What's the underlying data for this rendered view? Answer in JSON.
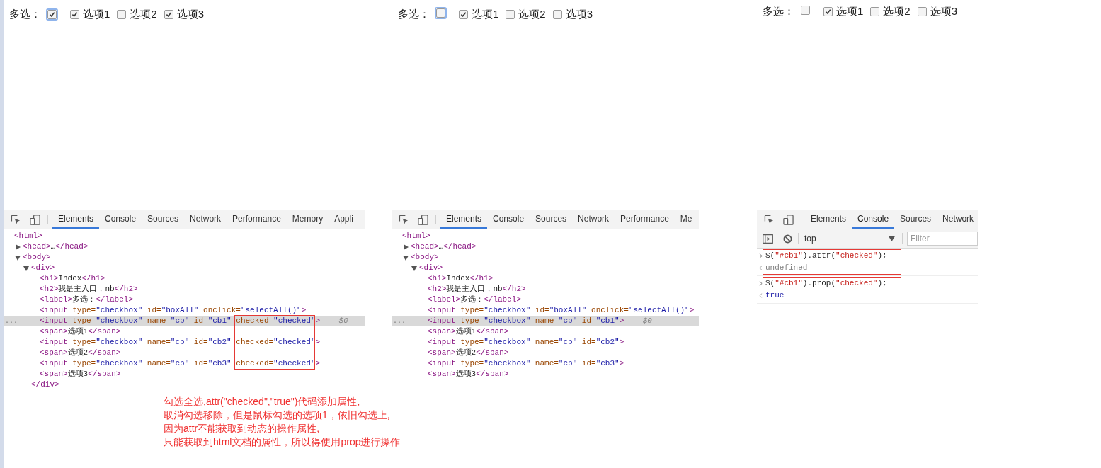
{
  "panels": [
    {
      "kind": "elements",
      "checkboxes": {
        "label": "多选：",
        "select_all": {
          "checked": true,
          "focused": true
        },
        "options": [
          {
            "label": "选项1",
            "checked": true
          },
          {
            "label": "选项2",
            "checked": false
          },
          {
            "label": "选项3",
            "checked": true
          }
        ]
      },
      "tabs": [
        {
          "label": "Elements",
          "selected": true
        },
        {
          "label": "Console",
          "selected": false
        },
        {
          "label": "Sources",
          "selected": false
        },
        {
          "label": "Network",
          "selected": false
        },
        {
          "label": "Performance",
          "selected": false
        },
        {
          "label": "Memory",
          "selected": false
        },
        {
          "label": "Appli",
          "selected": false
        }
      ],
      "highlight_box": true,
      "tree": [
        {
          "tokens": [
            {
              "kind": "tag",
              "text": "<html>"
            }
          ],
          "children": [
            {
              "expanded": false,
              "tokens": [
                {
                  "kind": "tag",
                  "text": "<head>"
                },
                {
                  "kind": "text",
                  "text": "…"
                },
                {
                  "kind": "tag",
                  "text": "</head>"
                }
              ]
            },
            {
              "expanded": true,
              "tokens": [
                {
                  "kind": "tag",
                  "text": "<body>"
                }
              ],
              "children": [
                {
                  "expanded": true,
                  "tokens": [
                    {
                      "kind": "tag",
                      "text": "<div>"
                    }
                  ],
                  "close": [
                    {
                      "kind": "tag",
                      "text": "</div>"
                    }
                  ],
                  "children": [
                    {
                      "tokens": [
                        {
                          "kind": "tag",
                          "text": "<h1>"
                        },
                        {
                          "kind": "text",
                          "text": "Index"
                        },
                        {
                          "kind": "tag",
                          "text": "</h1>"
                        }
                      ]
                    },
                    {
                      "tokens": [
                        {
                          "kind": "tag",
                          "text": "<h2>"
                        },
                        {
                          "kind": "text",
                          "text": "我是主入口，nb"
                        },
                        {
                          "kind": "tag",
                          "text": "</h2>"
                        }
                      ]
                    },
                    {
                      "tokens": [
                        {
                          "kind": "tag",
                          "text": "<label>"
                        },
                        {
                          "kind": "text",
                          "text": "多选："
                        },
                        {
                          "kind": "tag",
                          "text": "</label>"
                        }
                      ]
                    },
                    {
                      "tokens": [
                        {
                          "kind": "tag",
                          "text": "<input "
                        },
                        {
                          "kind": "attr",
                          "text": "type="
                        },
                        {
                          "kind": "value",
                          "text": "\"checkbox\""
                        },
                        {
                          "kind": "attr",
                          "text": " id="
                        },
                        {
                          "kind": "value",
                          "text": "\"boxAll\""
                        },
                        {
                          "kind": "attr",
                          "text": " onclick="
                        },
                        {
                          "kind": "value",
                          "text": "\"selectAll()\""
                        },
                        {
                          "kind": "tag",
                          "text": ">"
                        }
                      ]
                    },
                    {
                      "selected": true,
                      "gutter": "...",
                      "tokens": [
                        {
                          "kind": "tag",
                          "text": "<input "
                        },
                        {
                          "kind": "attr",
                          "text": "type="
                        },
                        {
                          "kind": "value",
                          "text": "\"checkbox\""
                        },
                        {
                          "kind": "attr",
                          "text": " name="
                        },
                        {
                          "kind": "value",
                          "text": "\"cb\""
                        },
                        {
                          "kind": "attr",
                          "text": " id="
                        },
                        {
                          "kind": "value",
                          "text": "\"cb1\" "
                        },
                        {
                          "kind": "boxed_attr",
                          "text": "checked="
                        },
                        {
                          "kind": "boxed_value",
                          "text": "\"checked\""
                        },
                        {
                          "kind": "tag",
                          "text": ">"
                        },
                        {
                          "kind": "note",
                          "text": " == $0"
                        }
                      ]
                    },
                    {
                      "tokens": [
                        {
                          "kind": "tag",
                          "text": "<span>"
                        },
                        {
                          "kind": "text",
                          "text": "选项1"
                        },
                        {
                          "kind": "tag",
                          "text": "</span>"
                        }
                      ]
                    },
                    {
                      "tokens": [
                        {
                          "kind": "tag",
                          "text": "<input "
                        },
                        {
                          "kind": "attr",
                          "text": "type="
                        },
                        {
                          "kind": "value",
                          "text": "\"checkbox\""
                        },
                        {
                          "kind": "attr",
                          "text": " name="
                        },
                        {
                          "kind": "value",
                          "text": "\"cb\""
                        },
                        {
                          "kind": "attr",
                          "text": " id="
                        },
                        {
                          "kind": "value",
                          "text": "\"cb2\" "
                        },
                        {
                          "kind": "boxed_attr",
                          "text": "checked="
                        },
                        {
                          "kind": "boxed_value",
                          "text": "\"checked\""
                        },
                        {
                          "kind": "tag",
                          "text": ">"
                        }
                      ]
                    },
                    {
                      "tokens": [
                        {
                          "kind": "tag",
                          "text": "<span>"
                        },
                        {
                          "kind": "text",
                          "text": "选项2"
                        },
                        {
                          "kind": "tag",
                          "text": "</span>"
                        }
                      ]
                    },
                    {
                      "tokens": [
                        {
                          "kind": "tag",
                          "text": "<input "
                        },
                        {
                          "kind": "attr",
                          "text": "type="
                        },
                        {
                          "kind": "value",
                          "text": "\"checkbox\""
                        },
                        {
                          "kind": "attr",
                          "text": " name="
                        },
                        {
                          "kind": "value",
                          "text": "\"cb\""
                        },
                        {
                          "kind": "attr",
                          "text": " id="
                        },
                        {
                          "kind": "value",
                          "text": "\"cb3\" "
                        },
                        {
                          "kind": "boxed_attr",
                          "text": "checked="
                        },
                        {
                          "kind": "boxed_value",
                          "text": "\"checked\""
                        },
                        {
                          "kind": "tag",
                          "text": ">"
                        }
                      ]
                    },
                    {
                      "tokens": [
                        {
                          "kind": "tag",
                          "text": "<span>"
                        },
                        {
                          "kind": "text",
                          "text": "选项3"
                        },
                        {
                          "kind": "tag",
                          "text": "</span>"
                        }
                      ]
                    }
                  ]
                }
              ]
            }
          ]
        }
      ],
      "note": [
        "勾选全选,attr(\"checked\",\"true\")代码添加属性,",
        "取消勾选移除，但是鼠标勾选的选项1，依旧勾选上,",
        "因为attr不能获取到动态的操作属性,",
        "只能获取到html文档的属性，所以得使用prop进行操作"
      ]
    },
    {
      "kind": "elements",
      "checkboxes": {
        "label": "多选：",
        "select_all": {
          "checked": false,
          "focused": true
        },
        "options": [
          {
            "label": "选项1",
            "checked": true
          },
          {
            "label": "选项2",
            "checked": false
          },
          {
            "label": "选项3",
            "checked": false
          }
        ]
      },
      "tabs": [
        {
          "label": "Elements",
          "selected": true
        },
        {
          "label": "Console",
          "selected": false
        },
        {
          "label": "Sources",
          "selected": false
        },
        {
          "label": "Network",
          "selected": false
        },
        {
          "label": "Performance",
          "selected": false
        },
        {
          "label": "Me",
          "selected": false
        }
      ],
      "tree": [
        {
          "tokens": [
            {
              "kind": "tag",
              "text": "<html>"
            }
          ],
          "children": [
            {
              "expanded": false,
              "tokens": [
                {
                  "kind": "tag",
                  "text": "<head>"
                },
                {
                  "kind": "text",
                  "text": "…"
                },
                {
                  "kind": "tag",
                  "text": "</head>"
                }
              ]
            },
            {
              "expanded": true,
              "tokens": [
                {
                  "kind": "tag",
                  "text": "<body>"
                }
              ],
              "children": [
                {
                  "expanded": true,
                  "tokens": [
                    {
                      "kind": "tag",
                      "text": "<div>"
                    }
                  ],
                  "children": [
                    {
                      "tokens": [
                        {
                          "kind": "tag",
                          "text": "<h1>"
                        },
                        {
                          "kind": "text",
                          "text": "Index"
                        },
                        {
                          "kind": "tag",
                          "text": "</h1>"
                        }
                      ]
                    },
                    {
                      "tokens": [
                        {
                          "kind": "tag",
                          "text": "<h2>"
                        },
                        {
                          "kind": "text",
                          "text": "我是主入口，nb"
                        },
                        {
                          "kind": "tag",
                          "text": "</h2>"
                        }
                      ]
                    },
                    {
                      "tokens": [
                        {
                          "kind": "tag",
                          "text": "<label>"
                        },
                        {
                          "kind": "text",
                          "text": "多选："
                        },
                        {
                          "kind": "tag",
                          "text": "</label>"
                        }
                      ]
                    },
                    {
                      "tokens": [
                        {
                          "kind": "tag",
                          "text": "<input "
                        },
                        {
                          "kind": "attr",
                          "text": "type="
                        },
                        {
                          "kind": "value",
                          "text": "\"checkbox\""
                        },
                        {
                          "kind": "attr",
                          "text": " id="
                        },
                        {
                          "kind": "value",
                          "text": "\"boxAll\""
                        },
                        {
                          "kind": "attr",
                          "text": " onclick="
                        },
                        {
                          "kind": "value",
                          "text": "\"selectAll()\""
                        },
                        {
                          "kind": "tag",
                          "text": ">"
                        }
                      ]
                    },
                    {
                      "selected": true,
                      "gutter": "...",
                      "tokens": [
                        {
                          "kind": "tag",
                          "text": "<input "
                        },
                        {
                          "kind": "attr",
                          "text": "type="
                        },
                        {
                          "kind": "value",
                          "text": "\"checkbox\""
                        },
                        {
                          "kind": "attr",
                          "text": " name="
                        },
                        {
                          "kind": "value",
                          "text": "\"cb\""
                        },
                        {
                          "kind": "attr",
                          "text": " id="
                        },
                        {
                          "kind": "value",
                          "text": "\"cb1\""
                        },
                        {
                          "kind": "tag",
                          "text": ">"
                        },
                        {
                          "kind": "note",
                          "text": " == $0"
                        }
                      ]
                    },
                    {
                      "tokens": [
                        {
                          "kind": "tag",
                          "text": "<span>"
                        },
                        {
                          "kind": "text",
                          "text": "选项1"
                        },
                        {
                          "kind": "tag",
                          "text": "</span>"
                        }
                      ]
                    },
                    {
                      "tokens": [
                        {
                          "kind": "tag",
                          "text": "<input "
                        },
                        {
                          "kind": "attr",
                          "text": "type="
                        },
                        {
                          "kind": "value",
                          "text": "\"checkbox\""
                        },
                        {
                          "kind": "attr",
                          "text": " name="
                        },
                        {
                          "kind": "value",
                          "text": "\"cb\""
                        },
                        {
                          "kind": "attr",
                          "text": " id="
                        },
                        {
                          "kind": "value",
                          "text": "\"cb2\""
                        },
                        {
                          "kind": "tag",
                          "text": ">"
                        }
                      ]
                    },
                    {
                      "tokens": [
                        {
                          "kind": "tag",
                          "text": "<span>"
                        },
                        {
                          "kind": "text",
                          "text": "选项2"
                        },
                        {
                          "kind": "tag",
                          "text": "</span>"
                        }
                      ]
                    },
                    {
                      "tokens": [
                        {
                          "kind": "tag",
                          "text": "<input "
                        },
                        {
                          "kind": "attr",
                          "text": "type="
                        },
                        {
                          "kind": "value",
                          "text": "\"checkbox\""
                        },
                        {
                          "kind": "attr",
                          "text": " name="
                        },
                        {
                          "kind": "value",
                          "text": "\"cb\""
                        },
                        {
                          "kind": "attr",
                          "text": " id="
                        },
                        {
                          "kind": "value",
                          "text": "\"cb3\""
                        },
                        {
                          "kind": "tag",
                          "text": ">"
                        }
                      ]
                    },
                    {
                      "tokens": [
                        {
                          "kind": "tag",
                          "text": "<span>"
                        },
                        {
                          "kind": "text",
                          "text": "选项3"
                        },
                        {
                          "kind": "tag",
                          "text": "</span>"
                        }
                      ]
                    }
                  ]
                }
              ]
            }
          ]
        }
      ]
    },
    {
      "kind": "console",
      "checkboxes": {
        "label": "多选：",
        "select_all": {
          "checked": false,
          "focused": false
        },
        "options": [
          {
            "label": "选项1",
            "checked": true
          },
          {
            "label": "选项2",
            "checked": false
          },
          {
            "label": "选项3",
            "checked": false
          }
        ]
      },
      "tabs": [
        {
          "label": "Elements",
          "selected": false
        },
        {
          "label": "Console",
          "selected": true
        },
        {
          "label": "Sources",
          "selected": false
        },
        {
          "label": "Network",
          "selected": false
        }
      ],
      "context": "top",
      "filter": {
        "placeholder": "Filter"
      },
      "entries": [
        {
          "boxed": true,
          "input": [
            {
              "kind": "code",
              "text": "$("
            },
            {
              "kind": "string",
              "text": "\"#cb1\""
            },
            {
              "kind": "code",
              "text": ").attr("
            },
            {
              "kind": "string",
              "text": "\"checked\""
            },
            {
              "kind": "code",
              "text": ");"
            }
          ],
          "result": {
            "kind": "undefined",
            "text": "undefined"
          }
        },
        {
          "boxed": true,
          "input": [
            {
              "kind": "code",
              "text": "$("
            },
            {
              "kind": "string",
              "text": "\"#cb1\""
            },
            {
              "kind": "code",
              "text": ").prop("
            },
            {
              "kind": "string",
              "text": "\"checked\""
            },
            {
              "kind": "code",
              "text": ");"
            }
          ],
          "result": {
            "kind": "boolean",
            "text": "true"
          }
        }
      ]
    }
  ]
}
